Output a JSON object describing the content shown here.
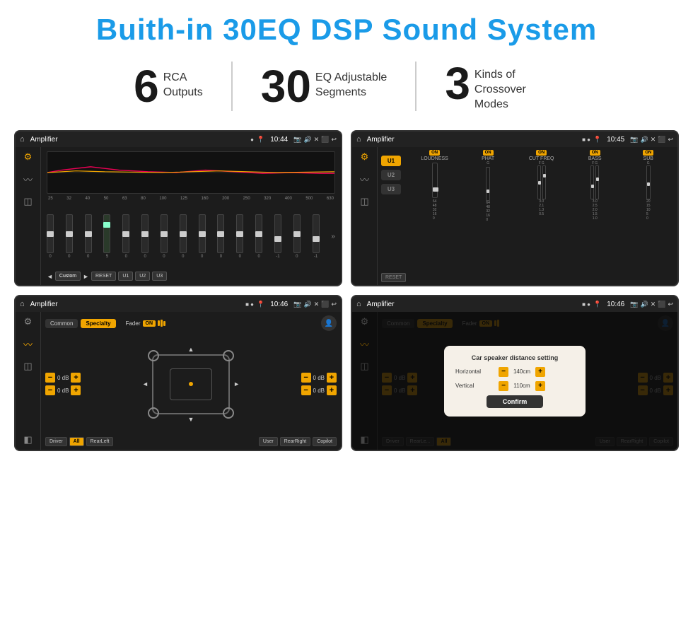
{
  "header": {
    "title": "Buith-in 30EQ DSP Sound System"
  },
  "stats": [
    {
      "number": "6",
      "label": "RCA\nOutputs"
    },
    {
      "number": "30",
      "label": "EQ Adjustable\nSegments"
    },
    {
      "number": "3",
      "label": "Kinds of\nCrossover Modes"
    }
  ],
  "screens": [
    {
      "id": "eq-screen",
      "topbar": {
        "title": "Amplifier",
        "time": "10:44"
      },
      "type": "eq"
    },
    {
      "id": "dsp-screen",
      "topbar": {
        "title": "Amplifier",
        "time": "10:45"
      },
      "type": "dsp"
    },
    {
      "id": "crossover-screen",
      "topbar": {
        "title": "Amplifier",
        "time": "10:46"
      },
      "type": "crossover"
    },
    {
      "id": "dialog-screen",
      "topbar": {
        "title": "Amplifier",
        "time": "10:46"
      },
      "type": "dialog"
    }
  ],
  "eq": {
    "freqs": [
      "25",
      "32",
      "40",
      "50",
      "63",
      "80",
      "100",
      "125",
      "160",
      "200",
      "250",
      "320",
      "400",
      "500",
      "630"
    ],
    "values": [
      "0",
      "0",
      "0",
      "5",
      "0",
      "0",
      "0",
      "0",
      "0",
      "0",
      "0",
      "0",
      "-1",
      "0",
      "-1"
    ],
    "presets": [
      "Custom",
      "RESET",
      "U1",
      "U2",
      "U3"
    ]
  },
  "dsp": {
    "channels": [
      "U1",
      "U2",
      "U3"
    ],
    "modules": [
      "LOUDNESS",
      "PHAT",
      "CUT FREQ",
      "BASS",
      "SUB"
    ],
    "reset": "RESET"
  },
  "crossover": {
    "tabs": [
      "Common",
      "Specialty"
    ],
    "fader_label": "Fader",
    "fader_on": "ON",
    "controls": [
      {
        "label": "0 dB"
      },
      {
        "label": "0 dB"
      },
      {
        "label": "0 dB"
      },
      {
        "label": "0 dB"
      }
    ],
    "buttons": [
      "Driver",
      "RearLeft",
      "All",
      "User",
      "RearRight",
      "Copilot"
    ]
  },
  "dialog": {
    "title": "Car speaker distance setting",
    "rows": [
      {
        "label": "Horizontal",
        "value": "140cm"
      },
      {
        "label": "Vertical",
        "value": "110cm"
      }
    ],
    "confirm": "Confirm"
  },
  "colors": {
    "accent": "#f0a500",
    "brand_blue": "#1a9be8",
    "dark_bg": "#1c1c1c",
    "topbar_bg": "#222"
  }
}
